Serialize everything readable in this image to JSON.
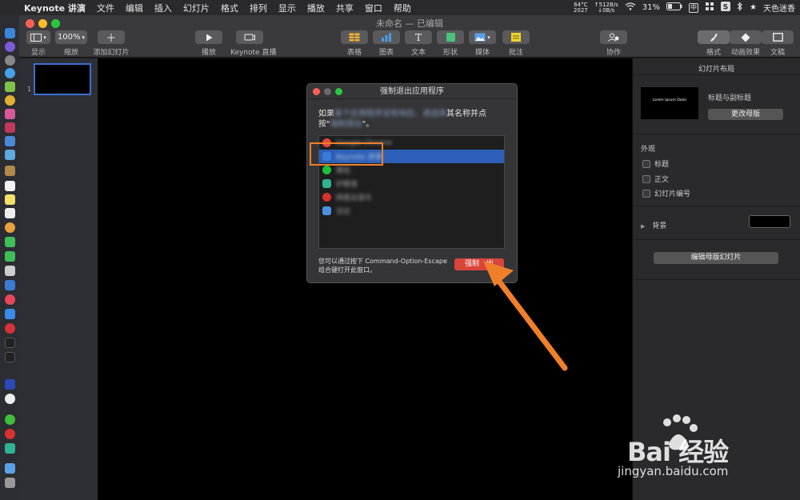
{
  "menubar": {
    "app_name": "Keynote 讲演",
    "menus": [
      "文件",
      "编辑",
      "插入",
      "幻灯片",
      "格式",
      "排列",
      "显示",
      "播放",
      "共享",
      "窗口",
      "帮助"
    ],
    "temp": "64°C",
    "rpm": "2027",
    "net_up": "↑512B/s",
    "net_down": "↓0B/s",
    "battery": "31%",
    "ime": "中",
    "clock": "天色迷香"
  },
  "window": {
    "title": "未命名 — 已编辑",
    "toolbar": {
      "view_label": "显示",
      "zoom_value": "100%",
      "zoom_label": "缩放",
      "add_slide_label": "添加幻灯片",
      "play_label": "播放",
      "live_label": "Keynote 直播",
      "table_label": "表格",
      "chart_label": "图表",
      "text_label": "文本",
      "shape_label": "形状",
      "media_label": "媒体",
      "comment_label": "批注",
      "collaborate_label": "协作",
      "format_label": "格式",
      "animate_label": "动画效果",
      "document_label": "文稿"
    }
  },
  "navigator": {
    "slide_number": "1"
  },
  "inspector": {
    "title": "幻灯片布局",
    "layout_thumb_text": "Lorem Ipsum Dolor",
    "layout_name": "标题与副标题",
    "change_master": "更改母版",
    "appearance_title": "外观",
    "appearance_items": [
      "标题",
      "正文",
      "幻灯片编号"
    ],
    "background_label": "背景",
    "edit_master": "编辑母版幻灯片",
    "bg_color": "#000000"
  },
  "dialog": {
    "title": "强制退出应用程序",
    "instr_a": "如果",
    "instr_blur_1": "某个应用程序没有响应，请选择",
    "instr_b": "其名称并点",
    "instr_c": "按\"",
    "instr_blur_2": "强制退出",
    "instr_d": "\"。",
    "apps": [
      {
        "name": "Google Chrome",
        "color": "#e8453c",
        "selected": false
      },
      {
        "name": "Keynote 讲演",
        "color": "#3a7bd5",
        "selected": true
      },
      {
        "name": "微信",
        "color": "#1fbf3c",
        "selected": false
      },
      {
        "name": "护眼宝",
        "color": "#2fb394",
        "selected": false
      },
      {
        "name": "网易云音乐",
        "color": "#d8322e",
        "selected": false
      },
      {
        "name": "访达",
        "color": "#4a90e2",
        "selected": false
      }
    ],
    "hint_line1": "您可以通过按下 Command-Option-Escape",
    "hint_line2": "组合键打开此窗口。",
    "force_quit_visible": "强制",
    "force_quit_tail": "出"
  },
  "watermark": {
    "brand": "Bai  经验",
    "url": "jingyan.baidu.com"
  },
  "colors": {
    "accent": "#2d5fb8",
    "danger": "#d9453b",
    "annotation": "#f07f2a"
  }
}
